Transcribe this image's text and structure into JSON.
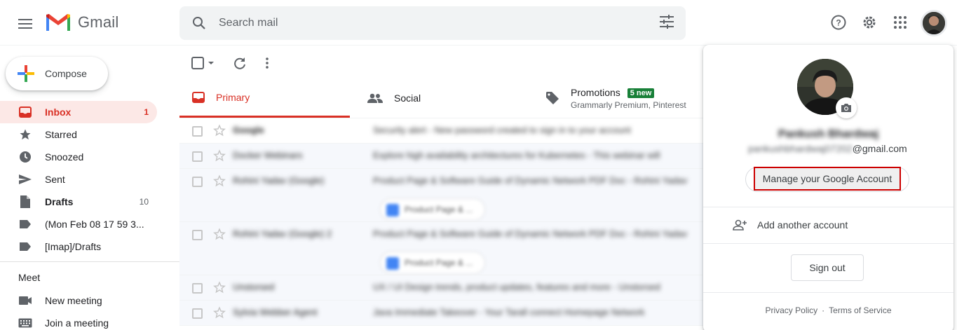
{
  "header": {
    "app_name": "Gmail",
    "search_placeholder": "Search mail"
  },
  "sidebar": {
    "compose_label": "Compose",
    "items": [
      {
        "label": "Inbox",
        "count": "1"
      },
      {
        "label": "Starred",
        "count": ""
      },
      {
        "label": "Snoozed",
        "count": ""
      },
      {
        "label": "Sent",
        "count": ""
      },
      {
        "label": "Drafts",
        "count": "10"
      },
      {
        "label": "(Mon Feb 08 17 59 3...",
        "count": ""
      },
      {
        "label": "[Imap]/Drafts",
        "count": ""
      }
    ],
    "meet_title": "Meet",
    "meet_items": [
      {
        "label": "New meeting"
      },
      {
        "label": "Join a meeting"
      }
    ]
  },
  "tabs": {
    "primary": "Primary",
    "social": "Social",
    "promotions": "Promotions",
    "promotions_badge": "5 new",
    "promotions_sub": "Grammarly Premium, Pinterest"
  },
  "emails": [
    {
      "sender": "Google",
      "subject": "Security alert - New password created to sign in to your account"
    },
    {
      "sender": "Docker Webinars",
      "subject": "Explore high availability architectures for Kubernetes - This webinar will"
    },
    {
      "sender": "Rohini Yadav (Google)",
      "subject": "Product Page & Software Guide of Dynamic Network PDF Doc - Rohini Yadav",
      "chip": "Product Page & ..."
    },
    {
      "sender": "Rohini Yadav (Google) 2",
      "subject": "Product Page & Software Guide of Dynamic Network PDF Doc - Rohini Yadav",
      "chip": "Product Page & ..."
    },
    {
      "sender": "Unstorsed",
      "subject": "UX / UI Design trends, product updates, features and more - Unstorsed"
    },
    {
      "sender": "Sylvia Webber Agent",
      "subject": "Java Immediate Takeover - Your Tarall connect Homepage Network"
    }
  ],
  "account": {
    "name": "Pankush Bhardwaj",
    "email_local": "pankushbhardwaj07202",
    "email_domain": "@gmail.com",
    "manage_label": "Manage your Google Account",
    "add_account_label": "Add another account",
    "sign_out_label": "Sign out",
    "privacy_label": "Privacy Policy",
    "footer_dot": "·",
    "terms_label": "Terms of Service"
  },
  "colors": {
    "accent_red": "#d93025",
    "badge_green": "#188038",
    "highlight_box": "#cc0000"
  }
}
